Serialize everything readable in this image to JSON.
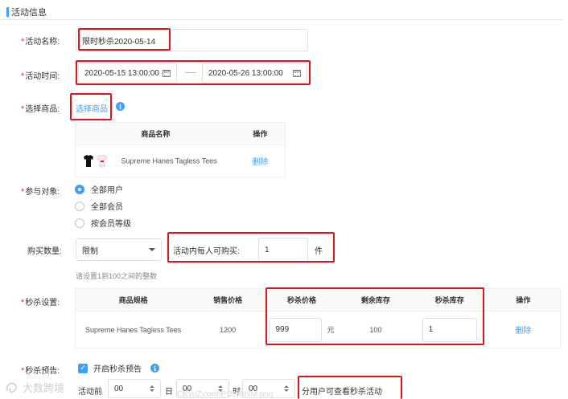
{
  "section": {
    "title": "活动信息"
  },
  "name_field": {
    "label": "活动名称:",
    "value": "限时秒杀2020-05-14"
  },
  "time_field": {
    "label": "活动时间:",
    "start": "2020-05-15 13:00:00",
    "end": "2020-05-26 13:00:00"
  },
  "product_field": {
    "label": "选择商品:",
    "select_link": "选择商品",
    "table": {
      "headers": [
        "商品名称",
        "操作"
      ],
      "rows": [
        {
          "name": "Supreme Hanes Tagless Tees",
          "action": "删除"
        }
      ]
    }
  },
  "audience_field": {
    "label": "参与对象:",
    "options": [
      {
        "label": "全部用户",
        "selected": true
      },
      {
        "label": "全部会员",
        "selected": false
      },
      {
        "label": "按会员等级",
        "selected": false
      }
    ]
  },
  "quantity_field": {
    "label": "购买数量:",
    "select_value": "限制",
    "per_person_label": "活动内每人可购买:",
    "per_person_value": "1",
    "unit": "件",
    "hint": "请设置1到100之间的整数"
  },
  "flash_field": {
    "label": "秒杀设置:",
    "headers": [
      "商品规格",
      "销售价格",
      "秒杀价格",
      "剩余库存",
      "秒杀库存",
      "操作"
    ],
    "rows": [
      {
        "spec": "Supreme Hanes Tagless Tees",
        "price": "1200",
        "flash_price": "999",
        "currency": "元",
        "remaining": "100",
        "flash_stock": "1",
        "action": "删除"
      }
    ]
  },
  "preview_field": {
    "label": "秒杀预告:",
    "checkbox_label": "开启秒杀预告",
    "checked": true,
    "before_label": "活动前",
    "day_value": "00",
    "day_unit": "日",
    "hour_value": "00",
    "hour_unit": "时",
    "minute_value": "00",
    "tail_text": "分用户可查看秒杀活动"
  },
  "watermark": {
    "text": "大数跨境",
    "file": "CKyuZyxmhPOWhhiM.png"
  },
  "colors": {
    "accent": "#409eff",
    "required": "#e03131",
    "highlight": "#e0131b"
  }
}
